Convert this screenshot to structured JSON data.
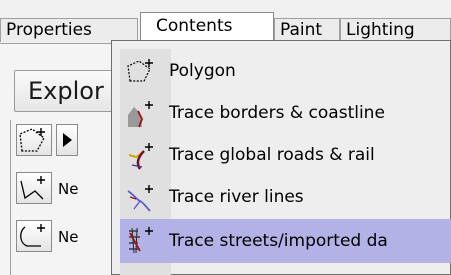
{
  "tabs": [
    {
      "label": "Properties",
      "active": false
    },
    {
      "label": "Contents",
      "active": true
    },
    {
      "label": "Paint",
      "active": false
    },
    {
      "label": "Lighting",
      "active": false
    }
  ],
  "panel": {
    "explore_label": "Explor",
    "tool_rows": [
      {
        "icon": "polygon-add-icon",
        "has_arrow": true
      },
      {
        "icon": "line-add-icon",
        "label": "Ne"
      },
      {
        "icon": "curve-add-icon",
        "label": "Ne"
      }
    ]
  },
  "menu": {
    "items": [
      {
        "label": "Polygon",
        "icon": "polygon-add-icon",
        "highlighted": false
      },
      {
        "label": "Trace borders & coastline",
        "icon": "trace-borders-icon",
        "highlighted": false
      },
      {
        "label": "Trace global roads & rail",
        "icon": "trace-roads-icon",
        "highlighted": false
      },
      {
        "label": "Trace river lines",
        "icon": "trace-rivers-icon",
        "highlighted": false
      },
      {
        "label": "Trace streets/imported da",
        "icon": "trace-streets-icon",
        "highlighted": true
      }
    ],
    "highlight_color": "#b3b2e6"
  }
}
